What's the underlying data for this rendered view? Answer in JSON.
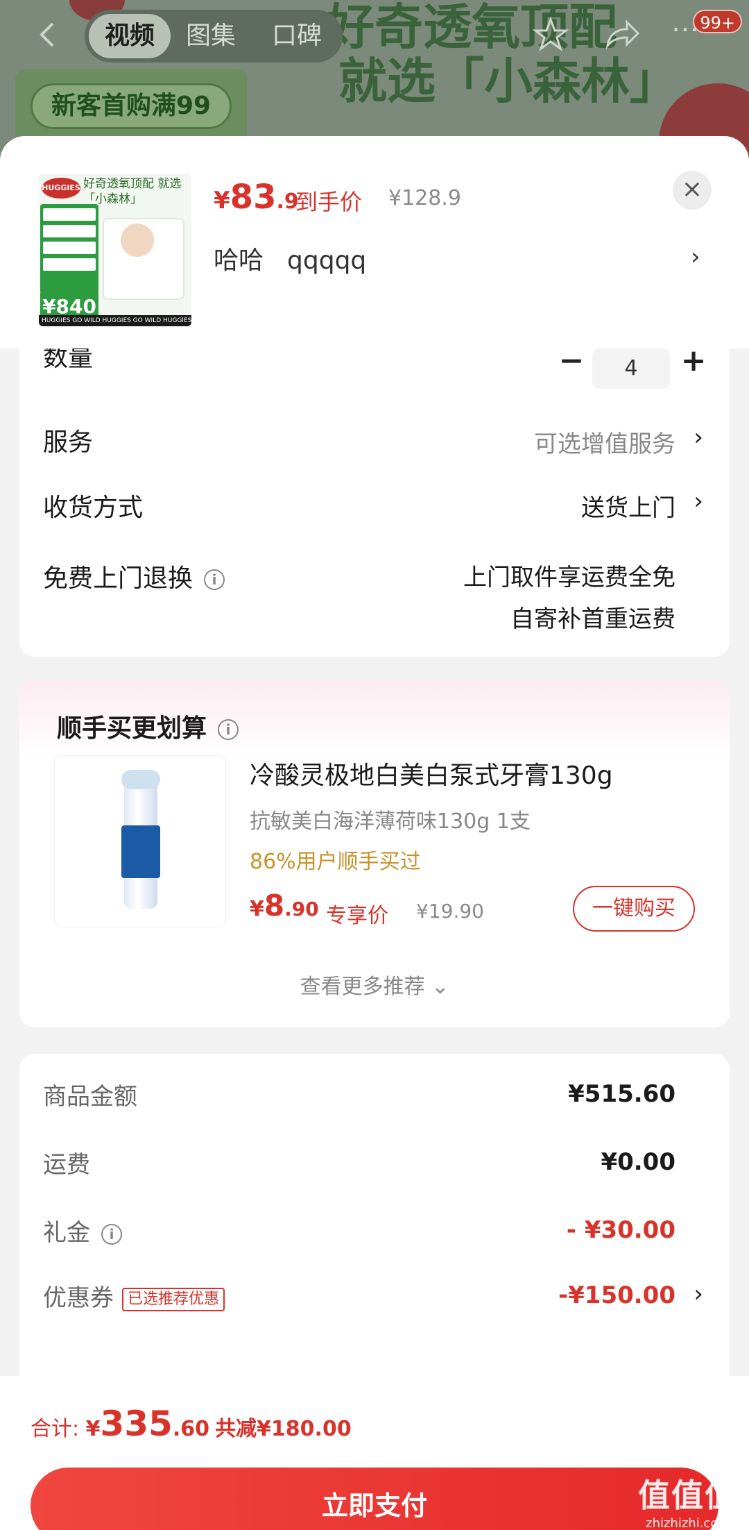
{
  "background": {
    "banner_line1": "好奇透氧顶配",
    "banner_line2": "就选「小森林」",
    "promo": "新客首购满99",
    "tabs": [
      "视频",
      "图集",
      "口碑"
    ],
    "badge": "99+"
  },
  "sheet_header": {
    "price_symbol": "¥",
    "price_int": "83",
    "price_dec": ".9",
    "price_tag": "到手价",
    "original_price": "¥128.9",
    "spec_1": "哈哈",
    "spec_2": "qqqqq",
    "thumb_title": "好奇透氧顶配 就选「小森林」",
    "thumb_price": "¥840",
    "thumb_strip": "HUGGIES GO WILD   HUGGIES GO WILD   HUGGIES"
  },
  "options": {
    "quantity_label": "数量",
    "quantity_value": "4",
    "service_label": "服务",
    "service_value": "可选增值服务",
    "delivery_label": "收货方式",
    "delivery_value": "送货上门",
    "return_label": "免费上门退换",
    "return_line1": "上门取件享运费全免",
    "return_line2": "自寄补首重运费"
  },
  "recommend": {
    "title": "顺手买更划算",
    "product_name": "冷酸灵极地白美白泵式牙膏130g",
    "product_spec": "抗敏美白海洋薄荷味130g 1支",
    "note": "86%用户顺手买过",
    "price_symbol": "¥",
    "price_int": "8",
    "price_dec": ".90",
    "price_tag": "专享价",
    "original_price": "¥19.90",
    "buy_button": "一键购买",
    "more": "查看更多推荐"
  },
  "summary": {
    "goods_label": "商品金额",
    "goods_value": "¥515.60",
    "shipping_label": "运费",
    "shipping_value": "¥0.00",
    "gift_label": "礼金",
    "gift_value": "- ¥30.00",
    "coupon_label": "优惠券",
    "coupon_tag": "已选推荐优惠",
    "coupon_value": "-¥150.00"
  },
  "footer": {
    "total_label": "合计: ",
    "total_symbol": "¥",
    "total_int": "335",
    "total_dec": ".60",
    "total_saved": "共减¥180.00",
    "pay_button": "立即支付",
    "watermark_1": "值值值",
    "watermark_2": "zhizhizhi.com"
  },
  "colors": {
    "accent_red": "#d8322a",
    "note_gold": "#c8922a"
  }
}
